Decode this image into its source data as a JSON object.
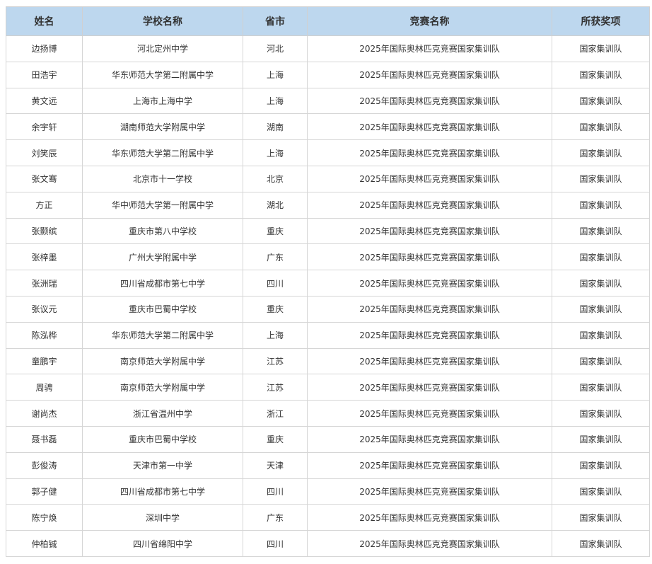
{
  "table": {
    "headers": [
      "姓名",
      "学校名称",
      "省市",
      "竞赛名称",
      "所获奖项"
    ],
    "rows": [
      [
        "边扬博",
        "河北定州中学",
        "河北",
        "2025年国际奥林匹克竞赛国家集训队",
        "国家集训队"
      ],
      [
        "田浩宇",
        "华东师范大学第二附属中学",
        "上海",
        "2025年国际奥林匹克竞赛国家集训队",
        "国家集训队"
      ],
      [
        "黄文远",
        "上海市上海中学",
        "上海",
        "2025年国际奥林匹克竞赛国家集训队",
        "国家集训队"
      ],
      [
        "余宇轩",
        "湖南师范大学附属中学",
        "湖南",
        "2025年国际奥林匹克竞赛国家集训队",
        "国家集训队"
      ],
      [
        "刘笑辰",
        "华东师范大学第二附属中学",
        "上海",
        "2025年国际奥林匹克竞赛国家集训队",
        "国家集训队"
      ],
      [
        "张文骞",
        "北京市十一学校",
        "北京",
        "2025年国际奥林匹克竞赛国家集训队",
        "国家集训队"
      ],
      [
        "方正",
        "华中师范大学第一附属中学",
        "湖北",
        "2025年国际奥林匹克竞赛国家集训队",
        "国家集训队"
      ],
      [
        "张颢缤",
        "重庆市第八中学校",
        "重庆",
        "2025年国际奥林匹克竞赛国家集训队",
        "国家集训队"
      ],
      [
        "张梓墨",
        "广州大学附属中学",
        "广东",
        "2025年国际奥林匹克竞赛国家集训队",
        "国家集训队"
      ],
      [
        "张洲瑞",
        "四川省成都市第七中学",
        "四川",
        "2025年国际奥林匹克竞赛国家集训队",
        "国家集训队"
      ],
      [
        "张议元",
        "重庆市巴蜀中学校",
        "重庆",
        "2025年国际奥林匹克竞赛国家集训队",
        "国家集训队"
      ],
      [
        "陈泓桦",
        "华东师范大学第二附属中学",
        "上海",
        "2025年国际奥林匹克竞赛国家集训队",
        "国家集训队"
      ],
      [
        "童鹏宇",
        "南京师范大学附属中学",
        "江苏",
        "2025年国际奥林匹克竞赛国家集训队",
        "国家集训队"
      ],
      [
        "周骋",
        "南京师范大学附属中学",
        "江苏",
        "2025年国际奥林匹克竞赛国家集训队",
        "国家集训队"
      ],
      [
        "谢尚杰",
        "浙江省温州中学",
        "浙江",
        "2025年国际奥林匹克竞赛国家集训队",
        "国家集训队"
      ],
      [
        "聂书磊",
        "重庆市巴蜀中学校",
        "重庆",
        "2025年国际奥林匹克竞赛国家集训队",
        "国家集训队"
      ],
      [
        "彭俊涛",
        "天津市第一中学",
        "天津",
        "2025年国际奥林匹克竞赛国家集训队",
        "国家集训队"
      ],
      [
        "郭子健",
        "四川省成都市第七中学",
        "四川",
        "2025年国际奥林匹克竞赛国家集训队",
        "国家集训队"
      ],
      [
        "陈宁焕",
        "深圳中学",
        "广东",
        "2025年国际奥林匹克竞赛国家集训队",
        "国家集训队"
      ],
      [
        "仲柏铖",
        "四川省绵阳中学",
        "四川",
        "2025年国际奥林匹克竞赛国家集训队",
        "国家集训队"
      ]
    ]
  }
}
